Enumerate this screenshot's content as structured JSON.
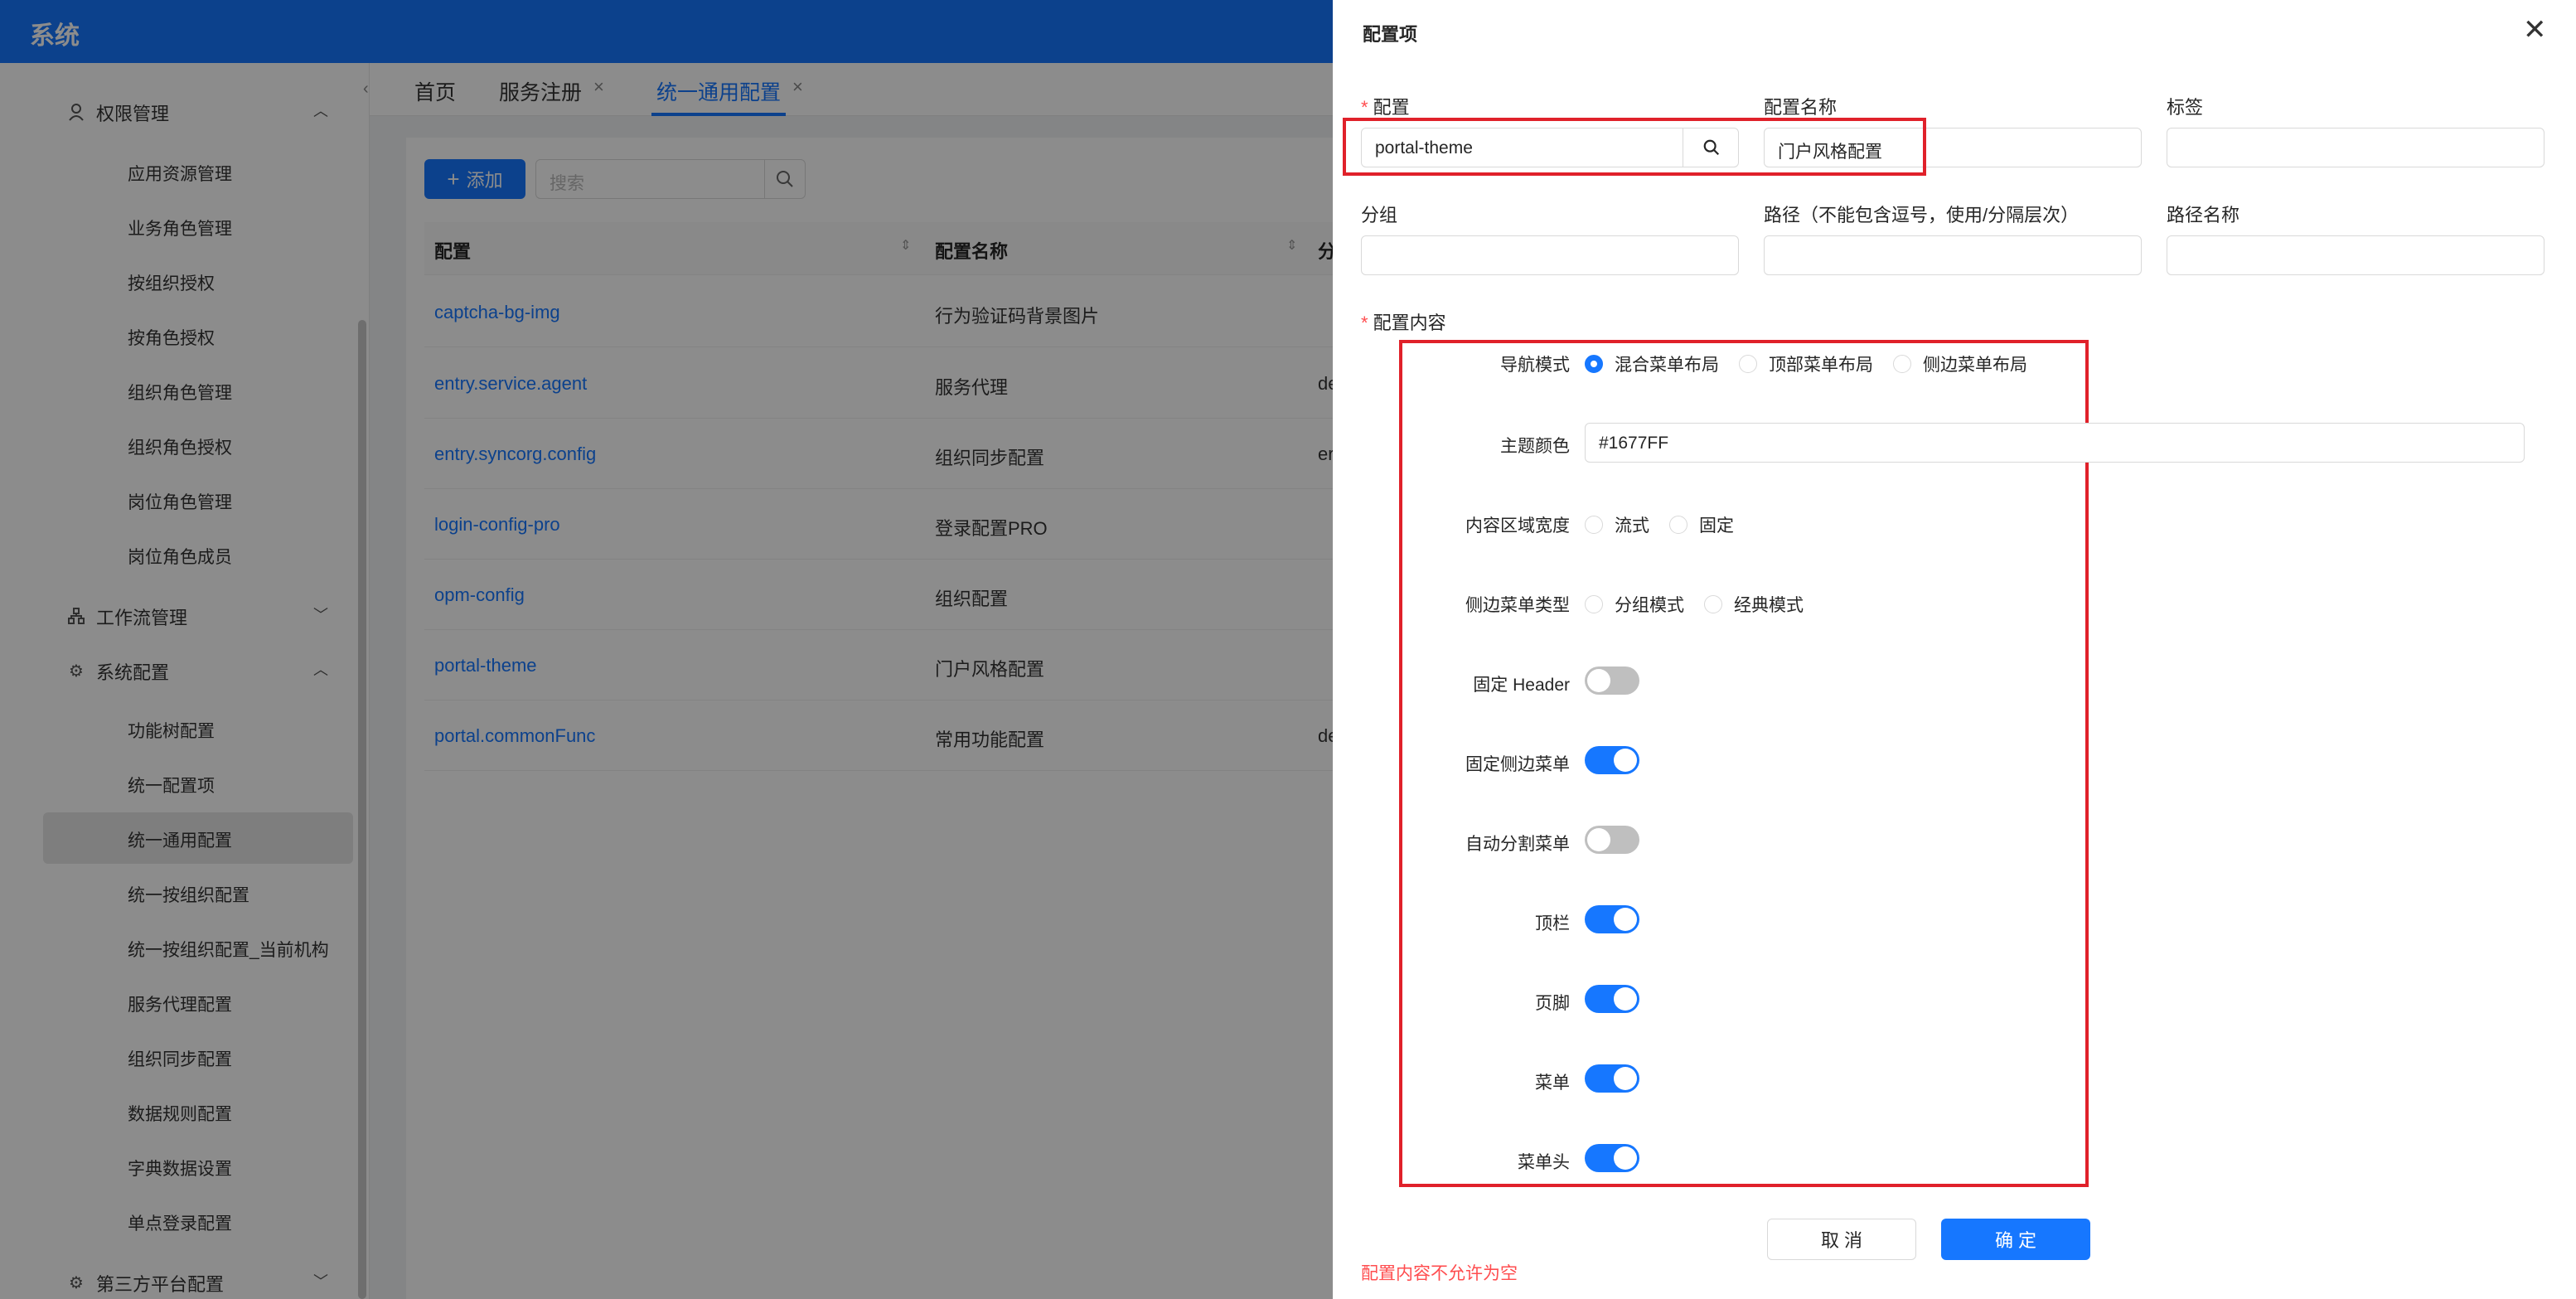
{
  "app": {
    "title": "系统"
  },
  "sidebar": {
    "groups": [
      {
        "label": "权限管理",
        "icon": "user-icon"
      },
      {
        "label": "工作流管理",
        "icon": "workflow-icon"
      },
      {
        "label": "系统配置",
        "icon": "gear-icon"
      },
      {
        "label": "第三方平台配置",
        "icon": "gear-icon"
      }
    ],
    "perm_items": [
      "应用资源管理",
      "业务角色管理",
      "按组织授权",
      "按角色授权",
      "组织角色管理",
      "组织角色授权",
      "岗位角色管理",
      "岗位角色成员"
    ],
    "sys_items": [
      "功能树配置",
      "统一配置项",
      "统一通用配置",
      "统一按组织配置",
      "统一按组织配置_当前机构",
      "服务代理配置",
      "组织同步配置",
      "数据规则配置",
      "字典数据设置",
      "单点登录配置"
    ]
  },
  "tabs": [
    {
      "label": "首页"
    },
    {
      "label": "服务注册"
    },
    {
      "label": "统一通用配置"
    }
  ],
  "toolbar": {
    "add_label": "添加",
    "search_placeholder": "搜索"
  },
  "table": {
    "headers": [
      "配置",
      "配置名称",
      "分"
    ],
    "rows": [
      {
        "key": "captcha-bg-img",
        "name": "行为验证码背景图片",
        "extra": ""
      },
      {
        "key": "entry.service.agent",
        "name": "服务代理",
        "extra": "de"
      },
      {
        "key": "entry.syncorg.config",
        "name": "组织同步配置",
        "extra": "er"
      },
      {
        "key": "login-config-pro",
        "name": "登录配置PRO",
        "extra": ""
      },
      {
        "key": "opm-config",
        "name": "组织配置",
        "extra": ""
      },
      {
        "key": "portal-theme",
        "name": "门户风格配置",
        "extra": ""
      },
      {
        "key": "portal.commonFunc",
        "name": "常用功能配置",
        "extra": "de"
      }
    ]
  },
  "drawer": {
    "title": "配置项",
    "fields": {
      "config_label": "配置",
      "config_value": "portal-theme",
      "config_name_label": "配置名称",
      "config_name_value": "门户风格配置",
      "tag_label": "标签",
      "group_label": "分组",
      "path_label": "路径（不能包含逗号，使用/分隔层次）",
      "path_name_label": "路径名称",
      "content_label": "配置内容"
    },
    "content": {
      "nav_mode_label": "导航模式",
      "nav_modes": [
        "混合菜单布局",
        "顶部菜单布局",
        "侧边菜单布局"
      ],
      "nav_mode_selected": "混合菜单布局",
      "theme_color_label": "主题颜色",
      "theme_color_value": "#1677FF",
      "content_width_label": "内容区域宽度",
      "content_widths": [
        "流式",
        "固定"
      ],
      "side_menu_type_label": "侧边菜单类型",
      "side_menu_types": [
        "分组模式",
        "经典模式"
      ],
      "switches": [
        {
          "label": "固定 Header",
          "on": false
        },
        {
          "label": "固定侧边菜单",
          "on": true
        },
        {
          "label": "自动分割菜单",
          "on": false
        },
        {
          "label": "顶栏",
          "on": true
        },
        {
          "label": "页脚",
          "on": true
        },
        {
          "label": "菜单",
          "on": true
        },
        {
          "label": "菜单头",
          "on": true
        }
      ]
    },
    "cancel_label": "取 消",
    "ok_label": "确 定",
    "error_text": "配置内容不允许为空"
  },
  "colors": {
    "primary": "#1677FF",
    "danger": "#ff4d4f",
    "highlight_box": "#e0212a"
  }
}
